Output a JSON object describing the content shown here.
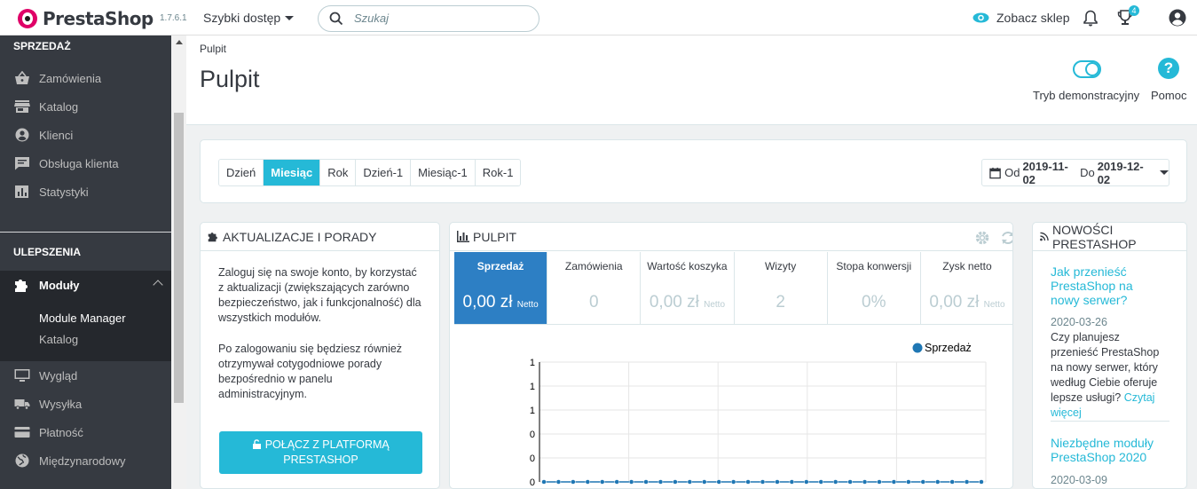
{
  "header": {
    "logo_text": "PrestaShop",
    "version": "1.7.6.1",
    "quick_access": "Szybki dostęp",
    "search_placeholder": "Szukaj",
    "view_shop": "Zobacz sklep",
    "notifications_count": "4"
  },
  "sidebar": {
    "section_sales": "SPRZEDAŻ",
    "sales_items": [
      {
        "label": "Zamówienia",
        "icon": "basket-icon"
      },
      {
        "label": "Katalog",
        "icon": "store-icon"
      },
      {
        "label": "Klienci",
        "icon": "account-circle-icon"
      },
      {
        "label": "Obsługa klienta",
        "icon": "chat-icon"
      },
      {
        "label": "Statystyki",
        "icon": "bar-chart-icon"
      }
    ],
    "section_improve": "ULEPSZENIA",
    "modules": {
      "label": "Moduły",
      "icon": "puzzle-icon"
    },
    "module_sub": [
      "Module Manager",
      "Katalog"
    ],
    "more_items": [
      {
        "label": "Wygląd",
        "icon": "monitor-icon"
      },
      {
        "label": "Wysyłka",
        "icon": "truck-icon"
      },
      {
        "label": "Płatność",
        "icon": "credit-card-icon"
      },
      {
        "label": "Międzynarodowy",
        "icon": "globe-icon"
      }
    ]
  },
  "page": {
    "breadcrumb": "Pulpit",
    "title": "Pulpit",
    "demo_mode": "Tryb demonstracyjny",
    "help": "Pomoc"
  },
  "filters": {
    "periods": [
      "Dzień",
      "Miesiąc",
      "Rok",
      "Dzień-1",
      "Miesiąc-1",
      "Rok-1"
    ],
    "active_period": "Miesiąc",
    "from_label": "Od",
    "from_date": "2019-11-02",
    "to_label": "Do",
    "to_date": "2019-12-02"
  },
  "tips_panel": {
    "title": "AKTUALIZACJE I PORADY",
    "text1": "Zaloguj się na swoje konto, by korzystać z aktualizacji (zwiększających zarówno bezpieczeństwo, jak i funkcjonalność) dla wszystkich modułów.",
    "text2": "Po zalogowaniu się będziesz również otrzymywał cotygodniowe porady bezpośrednio w panelu administracyjnym.",
    "button": "POŁĄCZ Z PLATFORMĄ PRESTASHOP"
  },
  "dashboard_panel": {
    "title": "PULPIT",
    "kpis": [
      {
        "label": "Sprzedaż",
        "value": "0,00 zł",
        "suffix": "Netto"
      },
      {
        "label": "Zamówienia",
        "value": "0",
        "suffix": ""
      },
      {
        "label": "Wartość koszyka",
        "value": "0,00 zł",
        "suffix": "Netto"
      },
      {
        "label": "Wizyty",
        "value": "2",
        "suffix": ""
      },
      {
        "label": "Stopa konwersji",
        "value": "0%",
        "suffix": ""
      },
      {
        "label": "Zysk netto",
        "value": "0,00 zł",
        "suffix": "Netto"
      }
    ]
  },
  "news_panel": {
    "title": "NOWOŚCI PRESTASHOP",
    "items": [
      {
        "title": "Jak przenieść PrestaShop na nowy serwer?",
        "date": "2020-03-26",
        "desc": "Czy planujesz przenieść PrestaShop na nowy serwer, który według Ciebie oferuje lepsze usługi?",
        "more": "Czytaj więcej"
      },
      {
        "title": "Niezbędne moduły PrestaShop 2020",
        "date": "2020-03-09"
      }
    ]
  },
  "chart_data": {
    "type": "line",
    "title": "",
    "xlabel": "",
    "ylabel": "",
    "y_tick_labels": [
      "1",
      "1",
      "1",
      "0",
      "0",
      "0"
    ],
    "series": [
      {
        "name": "Sprzedaż",
        "color": "#1f77b4",
        "values": [
          0,
          0,
          0,
          0,
          0,
          0,
          0,
          0,
          0,
          0,
          0,
          0,
          0,
          0,
          0,
          0,
          0,
          0,
          0,
          0,
          0,
          0,
          0,
          0,
          0,
          0,
          0,
          0,
          0,
          0,
          0
        ]
      }
    ],
    "legend": "top-right",
    "grid": true
  },
  "colors": {
    "accent": "#25b9d7",
    "sidebar_bg": "#363a41",
    "kpi_active": "#2d7fc4"
  }
}
